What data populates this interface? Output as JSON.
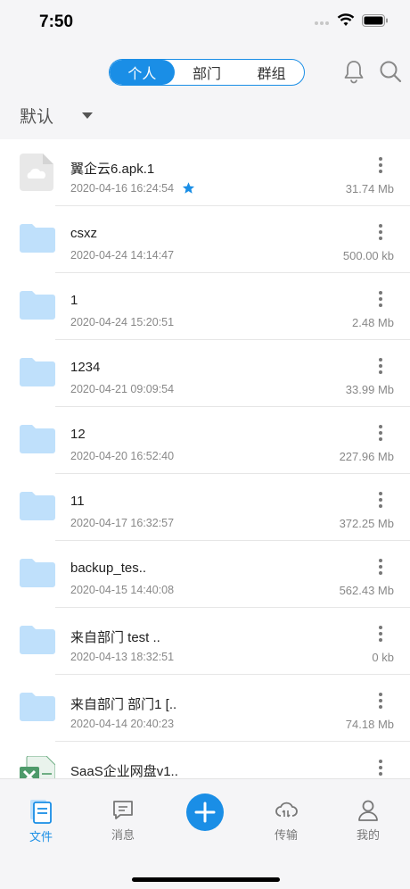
{
  "status": {
    "time": "7:50"
  },
  "header": {
    "segments": [
      "个人",
      "部门",
      "群组"
    ],
    "active_segment": 0,
    "sort_label": "默认"
  },
  "files": [
    {
      "name": "翼企云6.apk.1",
      "date": "2020-04-16 16:24:54",
      "size": "31.74 Mb",
      "type": "file",
      "starred": true
    },
    {
      "name": "csxz",
      "date": "2020-04-24 14:14:47",
      "size": "500.00 kb",
      "type": "folder"
    },
    {
      "name": "1",
      "date": "2020-04-24 15:20:51",
      "size": "2.48 Mb",
      "type": "folder"
    },
    {
      "name": "1234",
      "date": "2020-04-21 09:09:54",
      "size": "33.99 Mb",
      "type": "folder"
    },
    {
      "name": "12",
      "date": "2020-04-20 16:52:40",
      "size": "227.96 Mb",
      "type": "folder"
    },
    {
      "name": "11",
      "date": "2020-04-17 16:32:57",
      "size": "372.25 Mb",
      "type": "folder"
    },
    {
      "name": "backup_tes..",
      "date": "2020-04-15 14:40:08",
      "size": "562.43 Mb",
      "type": "folder"
    },
    {
      "name": "来自部门 test ..",
      "date": "2020-04-13 18:32:51",
      "size": "0 kb",
      "type": "folder"
    },
    {
      "name": "来自部门 部门1 [..",
      "date": "2020-04-14 20:40:23",
      "size": "74.18 Mb",
      "type": "folder"
    },
    {
      "name": "SaaS企业网盘v1..",
      "date": "",
      "size": "",
      "type": "excel"
    }
  ],
  "tabbar": {
    "tabs": [
      {
        "label": "文件",
        "icon": "document-icon",
        "active": true
      },
      {
        "label": "消息",
        "icon": "message-icon"
      },
      {
        "label": "传输",
        "icon": "cloud-transfer-icon"
      },
      {
        "label": "我的",
        "icon": "profile-icon"
      }
    ]
  },
  "colors": {
    "accent": "#1a8ee6",
    "folder": "#bfe0fb"
  }
}
